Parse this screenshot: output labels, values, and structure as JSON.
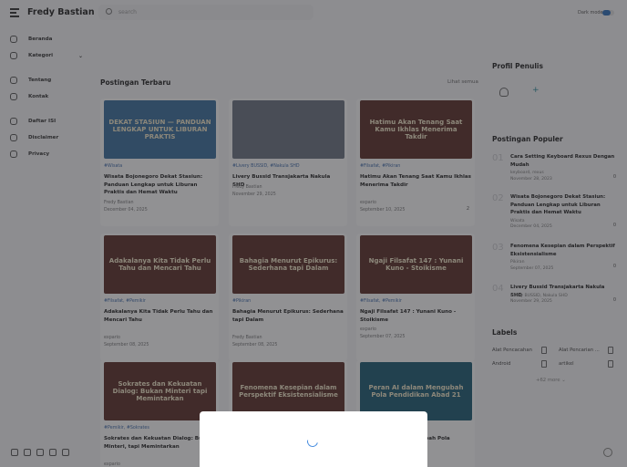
{
  "header": {
    "brand": "Fredy Bastian",
    "search_placeholder": "search",
    "dark_mode_label": "Dark mode",
    "dark_mode_on": true
  },
  "sidebar": {
    "items": [
      {
        "label": "Beranda",
        "icon": "home-icon"
      },
      {
        "label": "Kategori",
        "icon": "folder-icon",
        "has_chevron": true
      },
      {
        "label": "Tentang",
        "icon": "user-icon"
      },
      {
        "label": "Kontak",
        "icon": "mail-icon"
      },
      {
        "label": "Daftar ISI",
        "icon": "list-icon"
      },
      {
        "label": "Disclaimer",
        "icon": "chart-icon"
      },
      {
        "label": "Privacy",
        "icon": "shield-icon"
      }
    ],
    "social": [
      "facebook-icon",
      "instagram-icon",
      "twitter-icon",
      "youtube-icon",
      "blogger-icon"
    ]
  },
  "main": {
    "section_title": "Postingan Terbaru",
    "see_all": "Lihat semua",
    "posts": [
      {
        "image_text": "DEKAT STASIUN — PANDUAN LENGKAP UNTUK LIBURAN PRAKTIS",
        "image_color": "#3a6e9c",
        "tags": "#Wisata",
        "title": "Wisata Bojonegoro Dekat Stasiun: Panduan Lengkap untuk Liburan Praktis dan Hemat Waktu",
        "author": "Fredy Bastian",
        "date": "December 04, 2025",
        "comments": ""
      },
      {
        "image_text": "",
        "image_color": "#6b7280",
        "tags": "#Livery BUSSID, #Nakula SHD",
        "title": "Livery Bussid Transjakarta Nakula SHD",
        "author": "Fredy Bastian",
        "date": "November 29, 2025",
        "comments": ""
      },
      {
        "image_text": "Hatimu Akan Tenang Saat Kamu Ikhlas Menerima Takdir",
        "image_color": "#5a2e28",
        "tags": "#Filsafat, #Pikiran",
        "title": "Hatimu Akan Tenang Saat Kamu Ikhlas Menerima Takdir",
        "author": "expario",
        "date": "September 10, 2025",
        "comments": "2"
      },
      {
        "image_text": "Adakalanya Kita Tidak Perlu Tahu dan Mencari Tahu",
        "image_color": "#5a2e28",
        "tags": "#Filsafat, #Pemikir",
        "title": "Adakalanya Kita Tidak Perlu Tahu dan Mencari Tahu",
        "author": "expario",
        "date": "September 08, 2025",
        "comments": ""
      },
      {
        "image_text": "Bahagia Menurut Epikurus: Sederhana tapi Dalam",
        "image_color": "#5a2e28",
        "tags": "#Pikiran",
        "title": "Bahagia Menurut Epikurus: Sederhana tapi Dalam",
        "author": "Fredy Bastian",
        "date": "September 08, 2025",
        "comments": ""
      },
      {
        "image_text": "Ngaji Filsafat 147 : Yunani Kuno - Stoikisme",
        "image_color": "#5a2e28",
        "tags": "#Filsafat, #Pemikir",
        "title": "Ngaji Filsafat 147 : Yunani Kuno - Stoikisme",
        "author": "expario",
        "date": "September 07, 2025",
        "comments": ""
      },
      {
        "image_text": "Sokrates dan Kekuatan Dialog: Bukan Minteri tapi Memintarkan",
        "image_color": "#5a2e28",
        "tags": "#Pemikir, #Sokrates",
        "title": "Sokrates dan Kekuatan Dialog: Bukan Minteri, tapi Memintarkan",
        "author": "expario",
        "date": "September 07, 2025",
        "comments": ""
      },
      {
        "image_text": "Fenomena Kesepian dalam Perspektif Eksistensialisme",
        "image_color": "#5a2e28",
        "tags": "",
        "title": "",
        "author": "",
        "date": "",
        "comments": ""
      },
      {
        "image_text": "Peran AI dalam Mengubah Pola Pendidikan Abad 21",
        "image_color": "#1d5b73",
        "tags": "",
        "title": "Peran AI dalam Mengubah Pola",
        "author": "",
        "date": "",
        "comments": ""
      }
    ]
  },
  "right": {
    "profile_title": "Profil Penulis",
    "popular_title": "Postingan Populer",
    "popular": [
      {
        "num": "01",
        "title": "Cara Setting Keyboard Rexus Dengan Mudah",
        "tags": "keyboard, rexus",
        "date": "November 28, 2023",
        "comments": "0"
      },
      {
        "num": "02",
        "title": "Wisata Bojonegoro Dekat Stasiun: Panduan Lengkap untuk Liburan Praktis dan Hemat Waktu",
        "tags": "Wisata",
        "date": "December 04, 2025",
        "comments": "0"
      },
      {
        "num": "03",
        "title": "Fenomena Kesepian dalam Perspektif Eksistensialisme",
        "tags": "Pikiran",
        "date": "September 07, 2025",
        "comments": "0"
      },
      {
        "num": "04",
        "title": "Livery Bussid Transjakarta Nakula SHD",
        "tags": "Livery BUSSID, Nakula SHD",
        "date": "November 29, 2025",
        "comments": "0"
      }
    ],
    "labels_title": "Labels",
    "labels": [
      "Alat Pencacahan",
      "Alat Pencarian ...",
      "Android",
      "artikel"
    ],
    "labels_more": "+62 more"
  }
}
